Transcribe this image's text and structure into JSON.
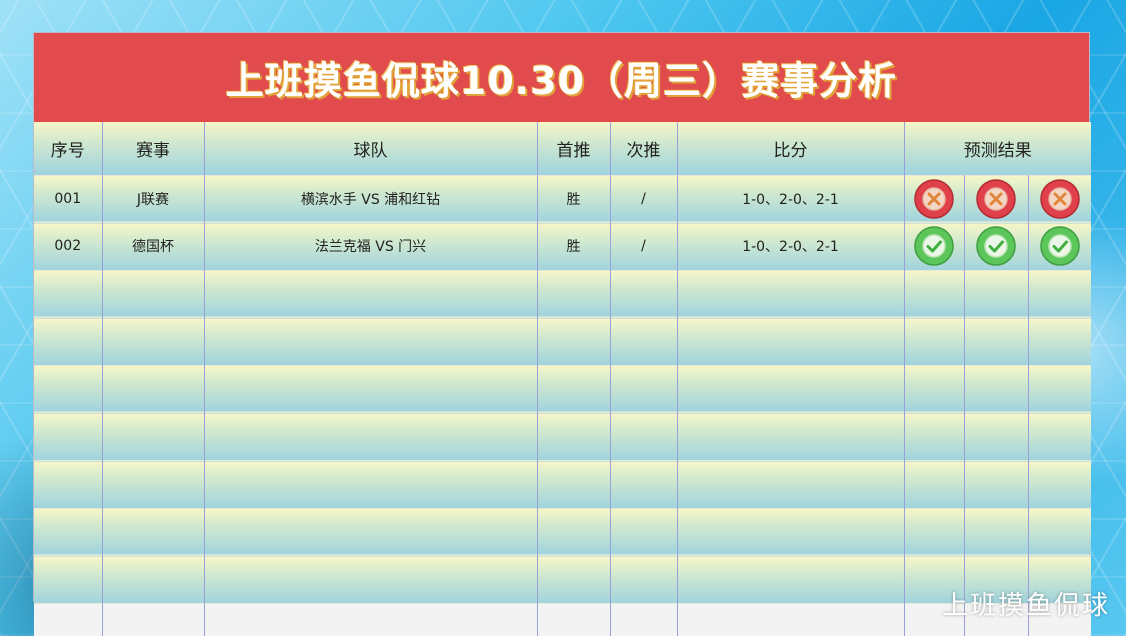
{
  "title": "上班摸鱼侃球10.30（周三）赛事分析",
  "headers": {
    "seq": "序号",
    "event": "赛事",
    "teams": "球队",
    "first_pick": "首推",
    "second_pick": "次推",
    "score": "比分",
    "result": "预测结果"
  },
  "rows": [
    {
      "seq": "001",
      "event": "J联赛",
      "teams": "横滨水手 VS 浦和红钻",
      "first_pick": "胜",
      "second_pick": "/",
      "score": "1-0、2-0、2-1",
      "results": [
        "wrong-icon",
        "wrong-icon",
        "wrong-icon"
      ]
    },
    {
      "seq": "002",
      "event": "德国杯",
      "teams": "法兰克福 VS 门兴",
      "first_pick": "胜",
      "second_pick": "/",
      "score": "1-0、2-0、2-1",
      "results": [
        "correct-icon",
        "correct-icon",
        "correct-icon"
      ]
    }
  ],
  "colors": {
    "title_bar": "#e24b4e",
    "wrong": "#e0404a",
    "correct": "#5cc65a"
  },
  "watermark": "上班摸鱼侃球"
}
